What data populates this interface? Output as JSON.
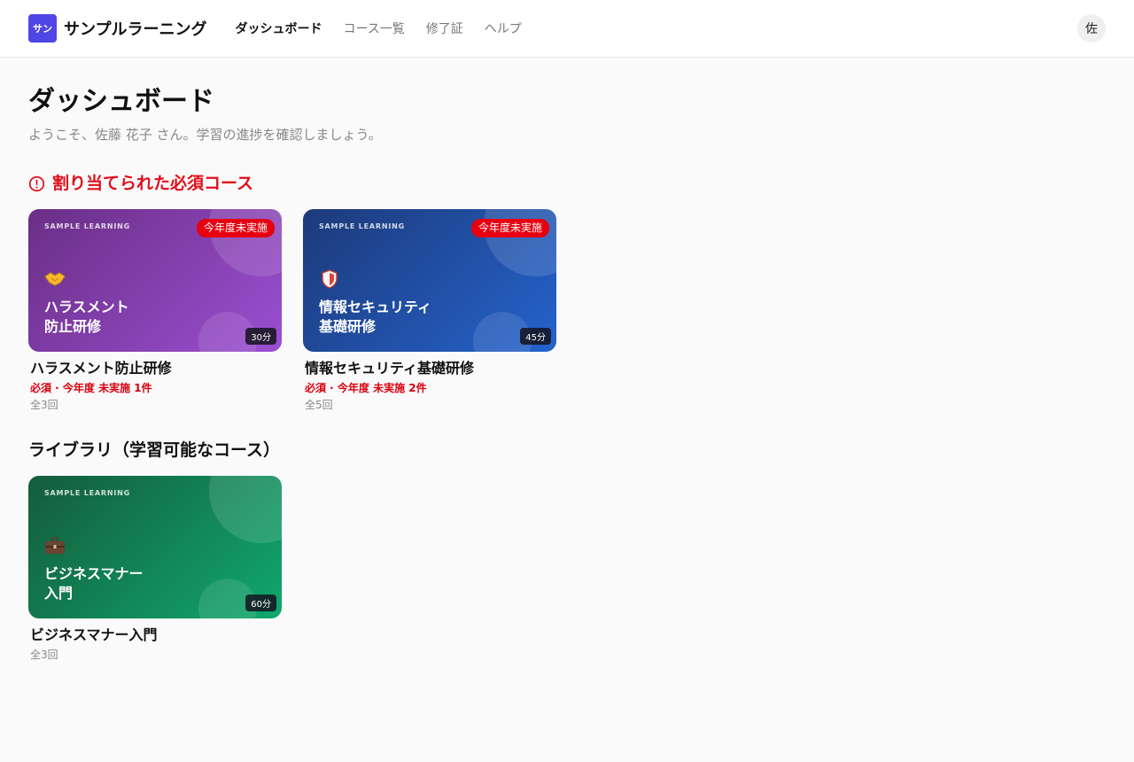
{
  "header": {
    "logo_badge": "サン",
    "brand_name": "サンプルラーニング",
    "nav": [
      {
        "label": "ダッシュボード"
      },
      {
        "label": "コース一覧"
      },
      {
        "label": "修了証"
      },
      {
        "label": "ヘルプ"
      }
    ],
    "active_nav": "ダッシュボード",
    "avatar_initial": "佐"
  },
  "page": {
    "title": "ダッシュボード",
    "subtitle": "ようこそ、佐藤 花子 さん。学習の進捗を確認しましょう。"
  },
  "required_section": {
    "heading": "割り当てられた必須コース",
    "icon": "alert-circle-icon",
    "color": "#e00f1a",
    "courses": [
      {
        "brand_mark": "SAMPLE LEARNING",
        "badge": "今年度未実施",
        "icon": "handshake-icon",
        "thumb_title_line1": "ハラスメント",
        "thumb_title_line2": "防止研修",
        "duration": "30分",
        "title": "ハラスメント防止研修",
        "status": "必須 · 今年度 未実施 1件",
        "sessions": "全3回",
        "theme_colors": [
          "#6a2f86",
          "#9b4fd1"
        ]
      },
      {
        "brand_mark": "SAMPLE LEARNING",
        "badge": "今年度未実施",
        "icon": "shield-icon",
        "thumb_title_line1": "情報セキュリティ",
        "thumb_title_line2": "基礎研修",
        "duration": "45分",
        "title": "情報セキュリティ基礎研修",
        "status": "必須 · 今年度 未実施 2件",
        "sessions": "全5回",
        "theme_colors": [
          "#1d3a7a",
          "#2563cc"
        ]
      }
    ]
  },
  "library_section": {
    "heading": "ライブラリ（学習可能なコース）",
    "courses": [
      {
        "brand_mark": "SAMPLE LEARNING",
        "icon": "briefcase-icon",
        "thumb_title_line1": "ビジネスマナー",
        "thumb_title_line2": "入門",
        "duration": "60分",
        "title": "ビジネスマナー入門",
        "sessions": "全3回",
        "theme_colors": [
          "#145c3c",
          "#10a86d"
        ]
      }
    ]
  }
}
